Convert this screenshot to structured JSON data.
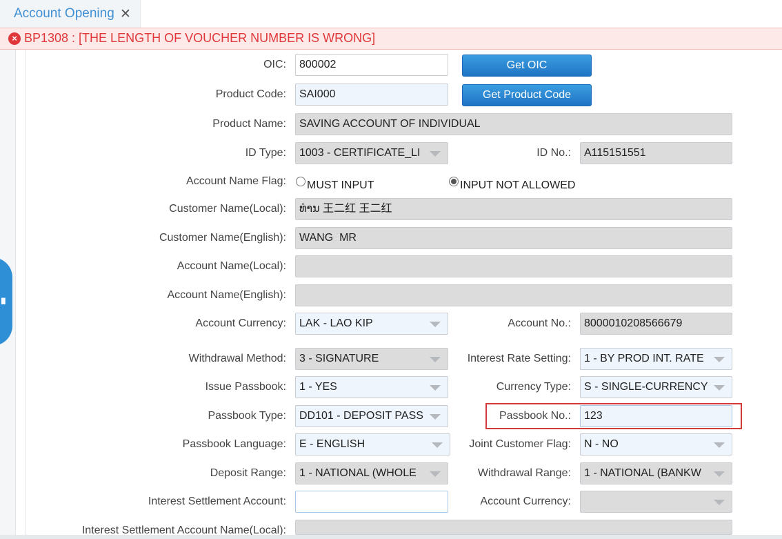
{
  "tab": {
    "title": "Account Opening",
    "close": "✕"
  },
  "error": {
    "icon": "×",
    "message": "BP1308 : [THE LENGTH OF VOUCHER NUMBER IS WRONG]"
  },
  "side_handle": {
    "icon": "menu-lines-icon",
    "glyph": "III"
  },
  "form": {
    "oic": {
      "label": "OIC:",
      "value": "800002",
      "button": "Get OIC"
    },
    "product_code": {
      "label": "Product Code:",
      "value": "SAI000",
      "button": "Get Product Code"
    },
    "product_name": {
      "label": "Product Name:",
      "value": "SAVING ACCOUNT OF INDIVIDUAL"
    },
    "id_type": {
      "label": "ID Type:",
      "value": "1003 - CERTIFICATE_LI"
    },
    "id_no": {
      "label": "ID No.:",
      "value": "A115151551"
    },
    "account_name_flag": {
      "label": "Account Name Flag:",
      "options": [
        {
          "label": "MUST INPUT",
          "selected": false
        },
        {
          "label": "INPUT NOT ALLOWED",
          "selected": true
        }
      ]
    },
    "customer_name_local": {
      "label": "Customer Name(Local):",
      "value": "ທ່ານ 王二红 王二红"
    },
    "customer_name_english": {
      "label": "Customer Name(English):",
      "value": "WANG  MR"
    },
    "account_name_local": {
      "label": "Account Name(Local):",
      "value": ""
    },
    "account_name_english": {
      "label": "Account Name(English):",
      "value": ""
    },
    "account_currency": {
      "label": "Account Currency:",
      "value": "LAK - LAO KIP"
    },
    "account_no": {
      "label": "Account No.:",
      "value": "8000010208566679"
    },
    "withdrawal_method": {
      "label": "Withdrawal Method:",
      "value": "3 - SIGNATURE"
    },
    "interest_rate_setting": {
      "label": "Interest Rate Setting:",
      "value": "1 - BY PROD INT. RATE"
    },
    "issue_passbook": {
      "label": "Issue Passbook:",
      "value": "1 - YES"
    },
    "currency_type": {
      "label": "Currency Type:",
      "value": "S - SINGLE-CURRENCY"
    },
    "passbook_type": {
      "label": "Passbook Type:",
      "value": "DD101 - DEPOSIT PASS"
    },
    "passbook_no": {
      "label": "Passbook No.:",
      "value": "123"
    },
    "passbook_language": {
      "label": "Passbook Language:",
      "value": "E - ENGLISH"
    },
    "joint_customer_flag": {
      "label": "Joint Customer Flag:",
      "value": "N - NO"
    },
    "deposit_range": {
      "label": "Deposit Range:",
      "value": "1 - NATIONAL (WHOLE"
    },
    "withdrawal_range": {
      "label": "Withdrawal Range:",
      "value": "1 - NATIONAL (BANKW"
    },
    "interest_settlement_account": {
      "label": "Interest Settlement Account:",
      "value": ""
    },
    "account_currency_2": {
      "label": "Account Currency:",
      "value": ""
    },
    "interest_settlement_account_name_local": {
      "label": "Interest Settlement Account Name(Local):",
      "value": ""
    }
  },
  "colors": {
    "accent": "#2f8fd6",
    "error": "#e0373b",
    "highlight_border": "#d33a3a"
  }
}
